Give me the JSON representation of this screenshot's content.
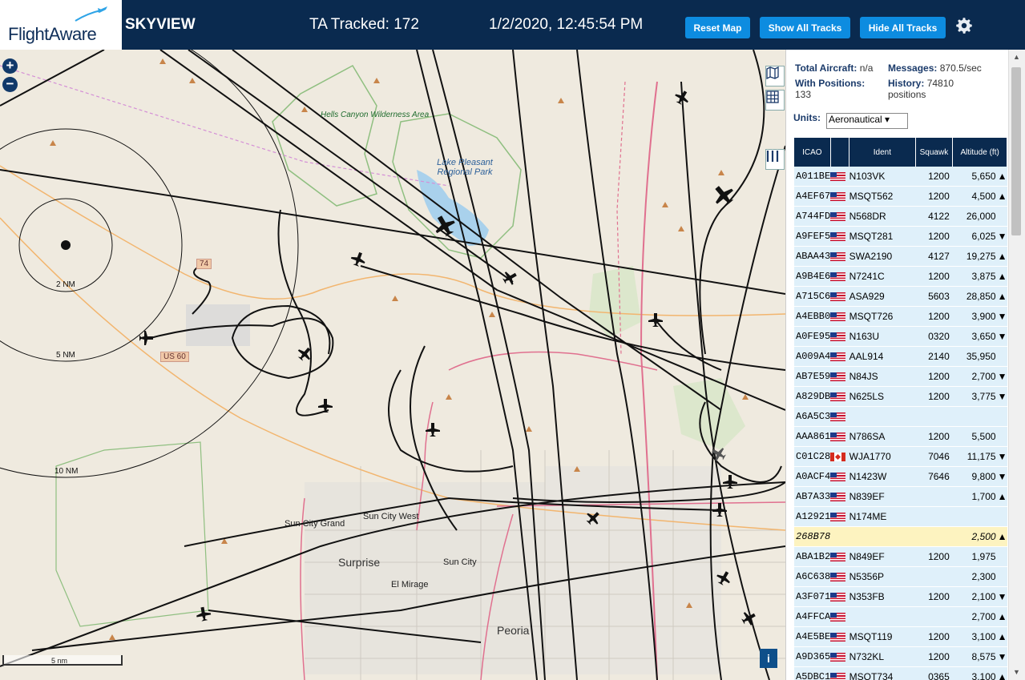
{
  "header": {
    "logo_text": "FlightAware",
    "app_title": "SKYVIEW",
    "tracked": "TA Tracked: 172",
    "datetime": "1/2/2020, 12:45:54 PM",
    "buttons": {
      "reset": "Reset Map",
      "show": "Show All Tracks",
      "hide": "Hide All Tracks"
    },
    "brand_color": "#0a2a4f",
    "button_color": "#0d8ce0"
  },
  "map": {
    "zoom_in": "+",
    "zoom_out": "−",
    "info": "i",
    "labels": {
      "hells_canyon": "Hells Canyon Wilderness Area",
      "lake_pleasant": "Lake Pleasant Regional Park",
      "sun_city_grand": "Sun City Grand",
      "sun_city_west": "Sun City West",
      "surprise": "Surprise",
      "sun_city": "Sun City",
      "el_mirage": "El Mirage",
      "peoria": "Peoria"
    },
    "rings": {
      "r2": "2 NM",
      "r5": "5 NM",
      "r10": "10 NM"
    },
    "road_badges": {
      "us60": "US 60",
      "sr74": "74"
    },
    "scale": "5 nm",
    "controls": [
      "map-icon",
      "grid-icon",
      "columns-icon"
    ]
  },
  "sidebar": {
    "stats": {
      "total_label": "Total Aircraft:",
      "total_value": "n/a",
      "messages_label": "Messages:",
      "messages_value": "870.5/sec",
      "positions_label": "With Positions:",
      "positions_value": "133",
      "history_label": "History:",
      "history_value": "74810 positions"
    },
    "units_label": "Units:",
    "units_value": "Aeronautical",
    "columns": {
      "icao": "ICAO",
      "ident": "Ident",
      "squawk": "Squawk",
      "altitude": "Altitude (ft)"
    },
    "rows": [
      {
        "icao": "A011BE",
        "flag": "us",
        "ident": "N103VK",
        "squawk": "1200",
        "alt": "5,650",
        "arrow": "▲"
      },
      {
        "icao": "A4EF67",
        "flag": "us",
        "ident": "MSQT562",
        "squawk": "1200",
        "alt": "4,500",
        "arrow": "▲"
      },
      {
        "icao": "A744FD",
        "flag": "us",
        "ident": "N568DR",
        "squawk": "4122",
        "alt": "26,000",
        "arrow": ""
      },
      {
        "icao": "A9FEF5",
        "flag": "us",
        "ident": "MSQT281",
        "squawk": "1200",
        "alt": "6,025",
        "arrow": "▼"
      },
      {
        "icao": "ABAA43",
        "flag": "us",
        "ident": "SWA2190",
        "squawk": "4127",
        "alt": "19,275",
        "arrow": "▲"
      },
      {
        "icao": "A9B4E6",
        "flag": "us",
        "ident": "N7241C",
        "squawk": "1200",
        "alt": "3,875",
        "arrow": "▲"
      },
      {
        "icao": "A715C6",
        "flag": "us",
        "ident": "ASA929",
        "squawk": "5603",
        "alt": "28,850",
        "arrow": "▲"
      },
      {
        "icao": "A4EBB0",
        "flag": "us",
        "ident": "MSQT726",
        "squawk": "1200",
        "alt": "3,900",
        "arrow": "▼"
      },
      {
        "icao": "A0FE95",
        "flag": "us",
        "ident": "N163U",
        "squawk": "0320",
        "alt": "3,650",
        "arrow": "▼"
      },
      {
        "icao": "A009A4",
        "flag": "us",
        "ident": "AAL914",
        "squawk": "2140",
        "alt": "35,950",
        "arrow": ""
      },
      {
        "icao": "AB7E59",
        "flag": "us",
        "ident": "N84JS",
        "squawk": "1200",
        "alt": "2,700",
        "arrow": "▼"
      },
      {
        "icao": "A829DB",
        "flag": "us",
        "ident": "N625LS",
        "squawk": "1200",
        "alt": "3,775",
        "arrow": "▼"
      },
      {
        "icao": "A6A5C3",
        "flag": "us",
        "ident": "",
        "squawk": "",
        "alt": "",
        "arrow": ""
      },
      {
        "icao": "AAA861",
        "flag": "us",
        "ident": "N786SA",
        "squawk": "1200",
        "alt": "5,500",
        "arrow": ""
      },
      {
        "icao": "C01C28",
        "flag": "ca",
        "ident": "WJA1770",
        "squawk": "7046",
        "alt": "11,175",
        "arrow": "▼"
      },
      {
        "icao": "A0ACF4",
        "flag": "us",
        "ident": "N1423W",
        "squawk": "7646",
        "alt": "9,800",
        "arrow": "▼"
      },
      {
        "icao": "AB7A33",
        "flag": "us",
        "ident": "N839EF",
        "squawk": "",
        "alt": "1,700",
        "arrow": "▲"
      },
      {
        "icao": "A12921",
        "flag": "us",
        "ident": "N174ME",
        "squawk": "",
        "alt": "",
        "arrow": ""
      },
      {
        "icao": "268B78",
        "flag": "",
        "ident": "",
        "squawk": "",
        "alt": "2,500",
        "arrow": "▲",
        "selected": true
      },
      {
        "icao": "ABA1B2",
        "flag": "us",
        "ident": "N849EF",
        "squawk": "1200",
        "alt": "1,975",
        "arrow": ""
      },
      {
        "icao": "A6C638",
        "flag": "us",
        "ident": "N5356P",
        "squawk": "",
        "alt": "2,300",
        "arrow": ""
      },
      {
        "icao": "A3F071",
        "flag": "us",
        "ident": "N353FB",
        "squawk": "1200",
        "alt": "2,100",
        "arrow": "▼"
      },
      {
        "icao": "A4FFCA",
        "flag": "us",
        "ident": "",
        "squawk": "",
        "alt": "2,700",
        "arrow": "▲"
      },
      {
        "icao": "A4E5BE",
        "flag": "us",
        "ident": "MSQT119",
        "squawk": "1200",
        "alt": "3,100",
        "arrow": "▲"
      },
      {
        "icao": "A9D365",
        "flag": "us",
        "ident": "N732KL",
        "squawk": "1200",
        "alt": "8,575",
        "arrow": "▼"
      },
      {
        "icao": "A5DBC1",
        "flag": "us",
        "ident": "MSQT734",
        "squawk": "0365",
        "alt": "3,100",
        "arrow": "▲"
      }
    ]
  }
}
